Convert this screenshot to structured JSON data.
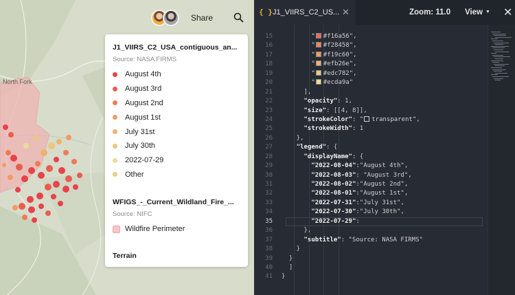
{
  "map": {
    "town_label": "North Fork",
    "toolbar": {
      "share_label": "Share",
      "search_icon": "search-icon",
      "avatar_icons": [
        "avatar-user-1",
        "avatar-user-2"
      ]
    },
    "legend_card": {
      "layers": [
        {
          "title": "J1_VIIRS_C2_USA_contiguous_an...",
          "source": "Source: NASA FIRMS",
          "entries": [
            {
              "label": "August 4th",
              "color": "#e8424a"
            },
            {
              "label": "August 3rd",
              "color": "#e95d4f"
            },
            {
              "label": "August 2nd",
              "color": "#ef7a57"
            },
            {
              "label": "August 1st",
              "color": "#f29b63"
            },
            {
              "label": "July 31st",
              "color": "#efb26e"
            },
            {
              "label": "July 30th",
              "color": "#edc782"
            },
            {
              "label": "2022-07-29",
              "color": "#ecda9a"
            },
            {
              "label": "Other",
              "color": "#e8cf86"
            }
          ]
        },
        {
          "title": "WFIGS_-_Current_Wildland_Fire_...",
          "source": "Source: NIFC",
          "entries": [
            {
              "label": "Wildfire Perimeter",
              "color": "#f5c6c6"
            }
          ]
        },
        {
          "title": "Terrain",
          "source": "",
          "entries": []
        }
      ]
    }
  },
  "editor": {
    "tab": {
      "icon_text": "{ }",
      "file_name": "J1_VIIRS_C2_US...",
      "close_icon": "close-icon"
    },
    "zoom_label": "Zoom:",
    "zoom_value": "11.0",
    "view_label": "View",
    "view_chevron_icon": "chevron-down-icon",
    "pane_close_icon": "close-icon",
    "active_line": 35,
    "lines": [
      {
        "n": 15,
        "indent": 0,
        "parts": [
          {
            "t": "        \"",
            "c": "s"
          },
          {
            "sw": "#f16a56"
          },
          {
            "t": "#f16a56\",",
            "c": "s"
          }
        ]
      },
      {
        "n": 16,
        "indent": 0,
        "parts": [
          {
            "t": "        \"",
            "c": "s"
          },
          {
            "sw": "#f28458"
          },
          {
            "t": "#f28458\",",
            "c": "s"
          }
        ]
      },
      {
        "n": 17,
        "indent": 0,
        "parts": [
          {
            "t": "        \"",
            "c": "s"
          },
          {
            "sw": "#f19c60"
          },
          {
            "t": "#f19c60\",",
            "c": "s"
          }
        ]
      },
      {
        "n": 18,
        "indent": 0,
        "parts": [
          {
            "t": "        \"",
            "c": "s"
          },
          {
            "sw": "#efb26e"
          },
          {
            "t": "#efb26e\",",
            "c": "s"
          }
        ]
      },
      {
        "n": 19,
        "indent": 0,
        "parts": [
          {
            "t": "        \"",
            "c": "s"
          },
          {
            "sw": "#edc782"
          },
          {
            "t": "#edc782\",",
            "c": "s"
          }
        ]
      },
      {
        "n": 20,
        "indent": 0,
        "parts": [
          {
            "t": "        \"",
            "c": "s"
          },
          {
            "sw": "#ecda9a"
          },
          {
            "t": "#ecda9a\"",
            "c": "s"
          }
        ]
      },
      {
        "n": 21,
        "indent": 0,
        "parts": [
          {
            "t": "      ],",
            "c": "p"
          }
        ]
      },
      {
        "n": 22,
        "indent": 0,
        "parts": [
          {
            "t": "      ",
            "c": "p"
          },
          {
            "t": "\"opacity\"",
            "c": "k"
          },
          {
            "t": ": 1,",
            "c": "p"
          }
        ]
      },
      {
        "n": 23,
        "indent": 0,
        "parts": [
          {
            "t": "      ",
            "c": "p"
          },
          {
            "t": "\"size\"",
            "c": "k"
          },
          {
            "t": ": [[4, 8]],",
            "c": "p"
          }
        ]
      },
      {
        "n": 24,
        "indent": 0,
        "parts": [
          {
            "t": "      ",
            "c": "p"
          },
          {
            "t": "\"strokeColor\"",
            "c": "k"
          },
          {
            "t": ": \"",
            "c": "p"
          },
          {
            "sw": "transparent"
          },
          {
            "t": "transparent\",",
            "c": "s"
          }
        ]
      },
      {
        "n": 25,
        "indent": 0,
        "parts": [
          {
            "t": "      ",
            "c": "p"
          },
          {
            "t": "\"strokeWidth\"",
            "c": "k"
          },
          {
            "t": ": 1",
            "c": "p"
          }
        ]
      },
      {
        "n": 26,
        "indent": 0,
        "parts": [
          {
            "t": "    },",
            "c": "p"
          }
        ]
      },
      {
        "n": 27,
        "indent": 0,
        "parts": [
          {
            "t": "    ",
            "c": "p"
          },
          {
            "t": "\"legend\"",
            "c": "k"
          },
          {
            "t": ": {",
            "c": "p"
          }
        ]
      },
      {
        "n": 28,
        "indent": 0,
        "parts": [
          {
            "t": "      ",
            "c": "p"
          },
          {
            "t": "\"displayName\"",
            "c": "k"
          },
          {
            "t": ": {",
            "c": "p"
          }
        ]
      },
      {
        "n": 29,
        "indent": 0,
        "parts": [
          {
            "t": "        ",
            "c": "p"
          },
          {
            "t": "\"2022-08-04\"",
            "c": "k"
          },
          {
            "t": ":\"August 4th\",",
            "c": "s"
          }
        ]
      },
      {
        "n": 30,
        "indent": 0,
        "parts": [
          {
            "t": "        ",
            "c": "p"
          },
          {
            "t": "\"2022-08-03\"",
            "c": "k"
          },
          {
            "t": ": \"August 3rd\",",
            "c": "s"
          }
        ]
      },
      {
        "n": 31,
        "indent": 0,
        "parts": [
          {
            "t": "        ",
            "c": "p"
          },
          {
            "t": "\"2022-08-02\"",
            "c": "k"
          },
          {
            "t": ":\"August 2nd\",",
            "c": "s"
          }
        ]
      },
      {
        "n": 32,
        "indent": 0,
        "parts": [
          {
            "t": "        ",
            "c": "p"
          },
          {
            "t": "\"2022-08-01\"",
            "c": "k"
          },
          {
            "t": ":\"August 1st\",",
            "c": "s"
          }
        ]
      },
      {
        "n": 33,
        "indent": 0,
        "parts": [
          {
            "t": "        ",
            "c": "p"
          },
          {
            "t": "\"2022-07-31\"",
            "c": "k"
          },
          {
            "t": ":\"July 31st\",",
            "c": "s"
          }
        ]
      },
      {
        "n": 34,
        "indent": 0,
        "parts": [
          {
            "t": "        ",
            "c": "p"
          },
          {
            "t": "\"2022-07-30\"",
            "c": "k"
          },
          {
            "t": ":\"July 30th\",",
            "c": "s"
          }
        ]
      },
      {
        "n": 35,
        "indent": 0,
        "parts": [
          {
            "t": "        ",
            "c": "p"
          },
          {
            "t": "\"2022-07-29\"",
            "c": "k"
          },
          {
            "t": ":",
            "c": "p"
          }
        ]
      },
      {
        "n": 36,
        "indent": 0,
        "parts": [
          {
            "t": "      },",
            "c": "p"
          }
        ]
      },
      {
        "n": 37,
        "indent": 0,
        "parts": [
          {
            "t": "      ",
            "c": "p"
          },
          {
            "t": "\"subtitle\"",
            "c": "k"
          },
          {
            "t": ": \"Source: NASA FIRMS\"",
            "c": "s"
          }
        ]
      },
      {
        "n": 38,
        "indent": 0,
        "parts": [
          {
            "t": "    }",
            "c": "p"
          }
        ]
      },
      {
        "n": 39,
        "indent": 0,
        "parts": [
          {
            "t": "  }",
            "c": "p"
          }
        ]
      },
      {
        "n": 40,
        "indent": 0,
        "parts": [
          {
            "t": "  ]",
            "c": "p"
          }
        ]
      },
      {
        "n": 41,
        "indent": 0,
        "parts": [
          {
            "t": "}",
            "c": "p"
          }
        ]
      }
    ]
  }
}
